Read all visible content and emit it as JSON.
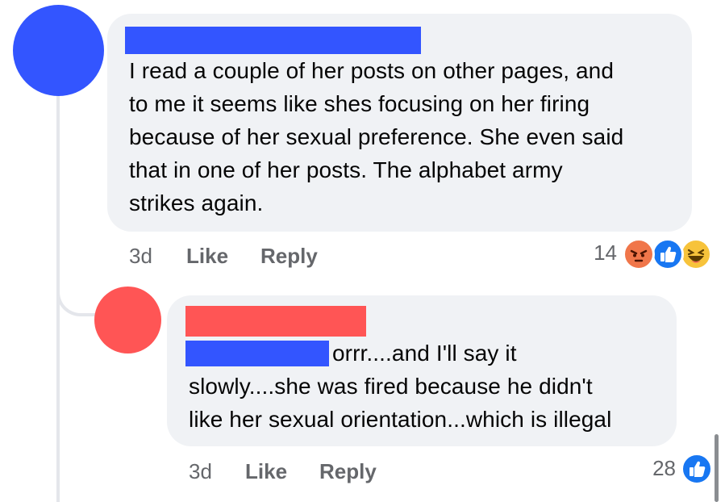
{
  "comments": [
    {
      "avatar_color": "#3355ff",
      "name_redaction_color": "#3355ff",
      "text_lines": [
        "I read a couple of her posts on other pages, and",
        "to me it seems like shes focusing on her firing",
        "because of her sexual preference. She even said",
        "that in one of her posts. The alphabet army",
        "strikes again."
      ],
      "time": "3d",
      "like_label": "Like",
      "reply_label": "Reply",
      "reaction_count": "14",
      "reactions": [
        "angry-reaction",
        "like-reaction",
        "haha-reaction"
      ]
    },
    {
      "avatar_color": "#ff5555",
      "name_redaction_color": "#ff5555",
      "mention_redaction_color": "#3355ff",
      "text_lines": [
        "orrr....and I'll say it",
        "slowly....she was fired because he didn't",
        "like her sexual orientation...which is illegal"
      ],
      "time": "3d",
      "like_label": "Like",
      "reply_label": "Reply",
      "reaction_count": "28",
      "reactions": [
        "like-reaction"
      ]
    }
  ]
}
